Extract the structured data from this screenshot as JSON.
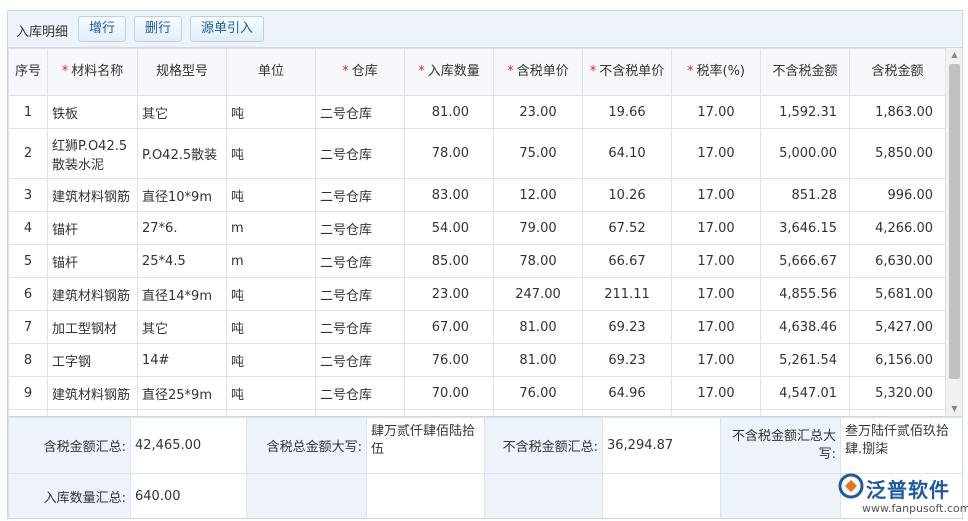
{
  "toolbar": {
    "title": "入库明细",
    "add_row_label": "增行",
    "delete_row_label": "删行",
    "source_import_label": "源单引入"
  },
  "columns": [
    {
      "label": "序号",
      "required": false
    },
    {
      "label": "材料名称",
      "required": true
    },
    {
      "label": "规格型号",
      "required": false
    },
    {
      "label": "单位",
      "required": false
    },
    {
      "label": "仓库",
      "required": true
    },
    {
      "label": "入库数量",
      "required": true
    },
    {
      "label": "含税单价",
      "required": true
    },
    {
      "label": "不含税单价",
      "required": true
    },
    {
      "label": "税率(%)",
      "required": true
    },
    {
      "label": "不含税金额",
      "required": false
    },
    {
      "label": "含税金额",
      "required": false
    }
  ],
  "rows": [
    [
      "1",
      "铁板",
      "其它",
      "吨",
      "二号仓库",
      "81.00",
      "23.00",
      "19.66",
      "17.00",
      "1,592.31",
      "1,863.00"
    ],
    [
      "2",
      "红狮P.O42.5散装水泥",
      "P.O42.5散装",
      "吨",
      "二号仓库",
      "78.00",
      "75.00",
      "64.10",
      "17.00",
      "5,000.00",
      "5,850.00"
    ],
    [
      "3",
      "建筑材料钢筋",
      "直径10*9m",
      "吨",
      "二号仓库",
      "83.00",
      "12.00",
      "10.26",
      "17.00",
      "851.28",
      "996.00"
    ],
    [
      "4",
      "锚杆",
      "27*6.",
      "m",
      "二号仓库",
      "54.00",
      "79.00",
      "67.52",
      "17.00",
      "3,646.15",
      "4,266.00"
    ],
    [
      "5",
      "锚杆",
      "25*4.5",
      "m",
      "二号仓库",
      "85.00",
      "78.00",
      "66.67",
      "17.00",
      "5,666.67",
      "6,630.00"
    ],
    [
      "6",
      "建筑材料钢筋",
      "直径14*9m",
      "吨",
      "二号仓库",
      "23.00",
      "247.00",
      "211.11",
      "17.00",
      "4,855.56",
      "5,681.00"
    ],
    [
      "7",
      "加工型钢材",
      "其它",
      "吨",
      "二号仓库",
      "67.00",
      "81.00",
      "69.23",
      "17.00",
      "4,638.46",
      "5,427.00"
    ],
    [
      "8",
      "工字钢",
      "14#",
      "吨",
      "二号仓库",
      "76.00",
      "81.00",
      "69.23",
      "17.00",
      "5,261.54",
      "6,156.00"
    ],
    [
      "9",
      "建筑材料钢筋",
      "直径25*9m",
      "吨",
      "二号仓库",
      "70.00",
      "76.00",
      "64.96",
      "17.00",
      "4,547.01",
      "5,320.00"
    ]
  ],
  "summary": {
    "tax_incl_total_label": "含税金额汇总:",
    "tax_incl_total_value": "42,465.00",
    "tax_incl_upper_label": "含税总金额大写:",
    "tax_incl_upper_value": "肆万贰仟肆佰陆拾伍",
    "tax_excl_total_label": "不含税金额汇总:",
    "tax_excl_total_value": "36,294.87",
    "tax_excl_upper_label": "不含税金额汇总大写:",
    "tax_excl_upper_value": "叁万陆仟贰佰玖拾肆.捌柒",
    "qty_total_label": "入库数量汇总:",
    "qty_total_value": "640.00"
  },
  "watermark": {
    "brand": "泛普软件",
    "url": "www.fanpusoft.com"
  },
  "colors": {
    "accent": "#1a5fa8",
    "required": "#e02020",
    "toolbar_bg": "#edf3f9",
    "border": "#dde3ea"
  }
}
